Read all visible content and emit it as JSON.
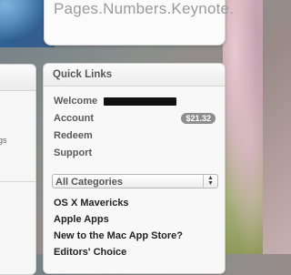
{
  "banner": {
    "text": "Pages.Numbers.Keynote."
  },
  "left_panel": {
    "fragment": "gs"
  },
  "quick_links": {
    "title": "Quick Links",
    "items": [
      {
        "label": "Welcome"
      },
      {
        "label": "Account",
        "badge": "$21.32"
      },
      {
        "label": "Redeem"
      },
      {
        "label": "Support"
      }
    ],
    "categories_select": "All Categories",
    "categories": [
      "OS X Mavericks",
      "Apple Apps",
      "New to the Mac App Store?",
      "Editors' Choice"
    ]
  },
  "colors": {
    "badge": "#8e8e8e",
    "panel_bg": "#f8f8f8"
  }
}
